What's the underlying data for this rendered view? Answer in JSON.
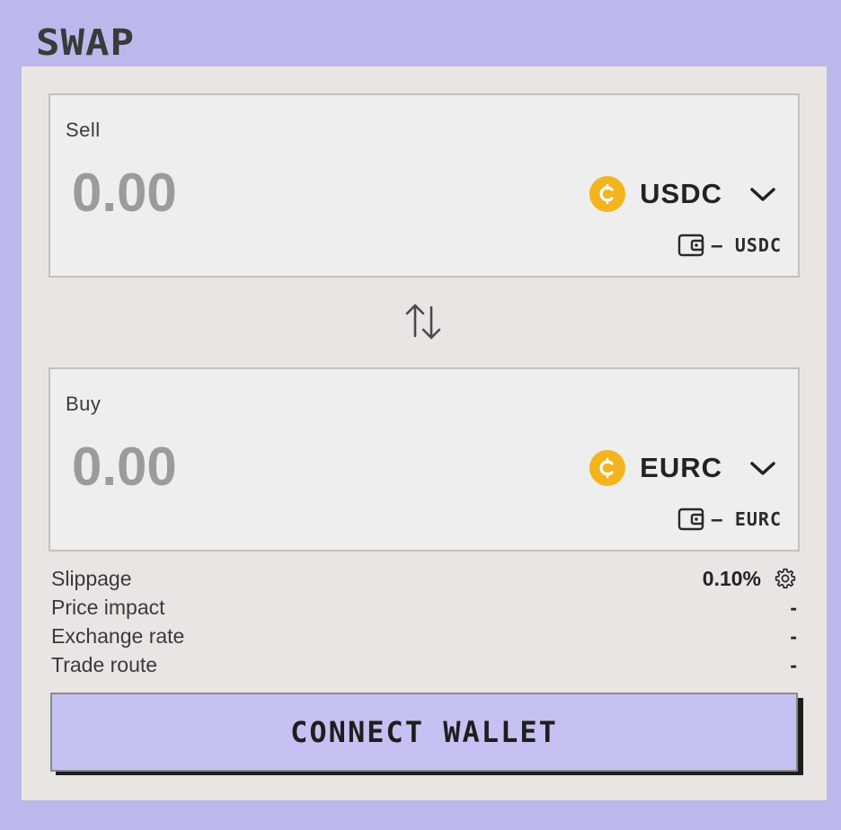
{
  "header": {
    "title": "SWAP"
  },
  "sell": {
    "label": "Sell",
    "amount_placeholder": "0.00",
    "token": "USDC",
    "token_icon": "usdc-coin-icon",
    "balance": "– USDC"
  },
  "switch": {
    "icon": "swap-arrows-icon"
  },
  "buy": {
    "label": "Buy",
    "amount_placeholder": "0.00",
    "token": "EURC",
    "token_icon": "eurc-coin-icon",
    "balance": "– EURC"
  },
  "details": {
    "slippage_label": "Slippage",
    "slippage_value": "0.10%",
    "price_impact_label": "Price impact",
    "price_impact_value": "-",
    "exchange_rate_label": "Exchange rate",
    "exchange_rate_value": "-",
    "trade_route_label": "Trade route",
    "trade_route_value": "-"
  },
  "actions": {
    "connect_label": "CONNECT WALLET"
  },
  "colors": {
    "background": "#bbb8eb",
    "panel": "#e9e5e2",
    "coin": "#f3b41e",
    "button": "#c5c2f3"
  }
}
